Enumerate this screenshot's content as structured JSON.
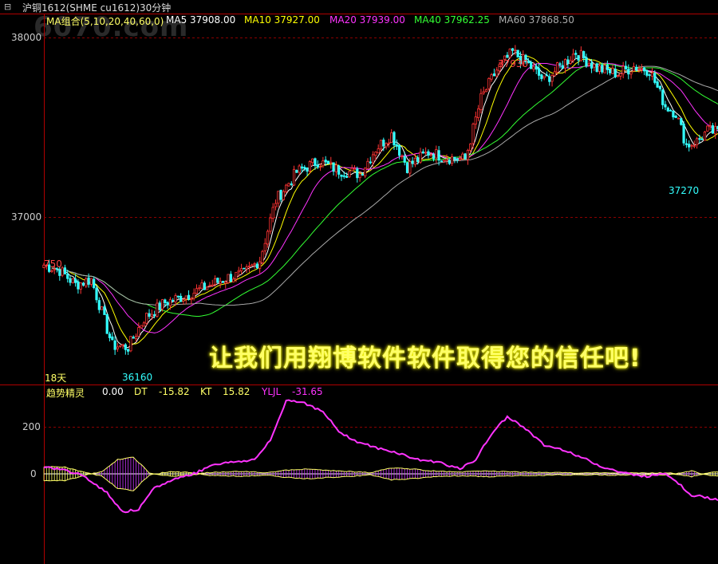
{
  "header": {
    "icon": "window-link-icon",
    "title": "沪铜1612(SHME cu1612)30分钟",
    "watermark": "6070.com"
  },
  "ma_legend": [
    {
      "text": "MA组合(5,10,20,40,60,0)",
      "color": "#ffff66"
    },
    {
      "text": "MA5 37908.00",
      "color": "#ffffff"
    },
    {
      "text": "MA10 37927.00",
      "color": "#ffff00"
    },
    {
      "text": "MA20 37939.00",
      "color": "#ff33ff"
    },
    {
      "text": "MA40 37962.25",
      "color": "#33ff33"
    },
    {
      "text": "MA60 37868.50",
      "color": "#aaaaaa"
    }
  ],
  "price_axis": {
    "ticks": [
      "38000",
      "37000"
    ]
  },
  "annotations": {
    "high": "37930",
    "low": "36160",
    "right_low": "37270",
    "left_value": "750",
    "period_label": "18天"
  },
  "banner": "让我们用翔博软件软件取得您的信任吧!",
  "indicator": {
    "legend": [
      {
        "text": "趋势精灵",
        "color": "#ffff66"
      },
      {
        "text": "0.00",
        "color": "#ffffff"
      },
      {
        "text": "DT",
        "color": "#ffff66"
      },
      {
        "text": "-15.82",
        "color": "#ffff66"
      },
      {
        "text": "KT",
        "color": "#ffff66"
      },
      {
        "text": "15.82",
        "color": "#ffff66"
      },
      {
        "text": "YLJL",
        "color": "#ff33ff"
      },
      {
        "text": "-31.65",
        "color": "#ff33ff"
      }
    ],
    "axis_ticks": [
      "200",
      "0"
    ]
  },
  "colors": {
    "up": "#ff3333",
    "down": "#33ffff",
    "grid": "#8b0000",
    "axis": "#b00000"
  },
  "chart_data": [
    {
      "type": "candlestick",
      "title": "沪铜1612(SHME cu1612)30分钟",
      "ylim": [
        36070,
        38060
      ],
      "yticks": [
        38000,
        37000
      ],
      "anchor_points": [
        [
          0,
          36730
        ],
        [
          6,
          36700
        ],
        [
          12,
          36620
        ],
        [
          18,
          36650
        ],
        [
          26,
          36280
        ],
        [
          32,
          36270
        ],
        [
          38,
          36430
        ],
        [
          46,
          36520
        ],
        [
          54,
          36560
        ],
        [
          62,
          36610
        ],
        [
          70,
          36660
        ],
        [
          76,
          36680
        ],
        [
          82,
          36760
        ],
        [
          88,
          37090
        ],
        [
          96,
          37250
        ],
        [
          104,
          37310
        ],
        [
          112,
          37260
        ],
        [
          120,
          37240
        ],
        [
          126,
          37380
        ],
        [
          132,
          37460
        ],
        [
          138,
          37280
        ],
        [
          146,
          37360
        ],
        [
          154,
          37330
        ],
        [
          160,
          37320
        ],
        [
          166,
          37660
        ],
        [
          172,
          37820
        ],
        [
          178,
          37920
        ],
        [
          184,
          37850
        ],
        [
          190,
          37760
        ],
        [
          196,
          37840
        ],
        [
          202,
          37920
        ],
        [
          210,
          37830
        ],
        [
          218,
          37800
        ],
        [
          224,
          37840
        ],
        [
          230,
          37820
        ],
        [
          236,
          37620
        ],
        [
          240,
          37580
        ],
        [
          244,
          37400
        ],
        [
          248,
          37420
        ],
        [
          252,
          37480
        ],
        [
          256,
          37470
        ]
      ],
      "candle_count": 257,
      "high": 37930,
      "low": 36160,
      "series": [
        {
          "name": "MA5",
          "value": 37908.0
        },
        {
          "name": "MA10",
          "value": 37927.0
        },
        {
          "name": "MA20",
          "value": 37939.0
        },
        {
          "name": "MA40",
          "value": 37962.25
        },
        {
          "name": "MA60",
          "value": 37868.5
        }
      ]
    },
    {
      "type": "area",
      "title": "趋势精灵",
      "ylim": [
        -380,
        370
      ],
      "yticks": [
        200,
        0
      ],
      "DT_anchor": [
        [
          0,
          30
        ],
        [
          8,
          28
        ],
        [
          16,
          5
        ],
        [
          22,
          -10
        ],
        [
          28,
          -60
        ],
        [
          34,
          -70
        ],
        [
          40,
          -5
        ],
        [
          48,
          10
        ],
        [
          56,
          5
        ],
        [
          62,
          -5
        ],
        [
          68,
          -8
        ],
        [
          76,
          -10
        ],
        [
          84,
          -5
        ],
        [
          92,
          -15
        ],
        [
          100,
          -20
        ],
        [
          108,
          -15
        ],
        [
          116,
          -10
        ],
        [
          124,
          -5
        ],
        [
          132,
          -25
        ],
        [
          140,
          -20
        ],
        [
          148,
          -12
        ],
        [
          156,
          -8
        ],
        [
          164,
          -10
        ],
        [
          170,
          -12
        ],
        [
          178,
          -8
        ],
        [
          186,
          -6
        ],
        [
          194,
          -5
        ],
        [
          202,
          -4
        ],
        [
          210,
          -4
        ],
        [
          218,
          -5
        ],
        [
          226,
          -3
        ],
        [
          234,
          -4
        ],
        [
          240,
          -2
        ],
        [
          246,
          -12
        ],
        [
          252,
          5
        ],
        [
          256,
          10
        ]
      ],
      "KT_anchor": [
        [
          0,
          -30
        ],
        [
          8,
          -28
        ],
        [
          16,
          -5
        ],
        [
          22,
          10
        ],
        [
          28,
          60
        ],
        [
          34,
          70
        ],
        [
          40,
          5
        ],
        [
          48,
          -10
        ],
        [
          56,
          -5
        ],
        [
          62,
          5
        ],
        [
          68,
          8
        ],
        [
          76,
          10
        ],
        [
          84,
          5
        ],
        [
          92,
          15
        ],
        [
          100,
          20
        ],
        [
          108,
          15
        ],
        [
          116,
          10
        ],
        [
          124,
          5
        ],
        [
          132,
          25
        ],
        [
          140,
          20
        ],
        [
          148,
          12
        ],
        [
          156,
          8
        ],
        [
          164,
          10
        ],
        [
          170,
          12
        ],
        [
          178,
          8
        ],
        [
          186,
          6
        ],
        [
          194,
          5
        ],
        [
          202,
          4
        ],
        [
          210,
          4
        ],
        [
          218,
          5
        ],
        [
          226,
          3
        ],
        [
          234,
          4
        ],
        [
          240,
          2
        ],
        [
          246,
          12
        ],
        [
          252,
          -5
        ],
        [
          256,
          -10
        ]
      ],
      "YLJL_anchor": [
        [
          0,
          30
        ],
        [
          6,
          20
        ],
        [
          12,
          5
        ],
        [
          18,
          -30
        ],
        [
          24,
          -80
        ],
        [
          30,
          -160
        ],
        [
          36,
          -150
        ],
        [
          42,
          -60
        ],
        [
          50,
          -20
        ],
        [
          58,
          5
        ],
        [
          64,
          40
        ],
        [
          72,
          50
        ],
        [
          80,
          60
        ],
        [
          86,
          140
        ],
        [
          92,
          310
        ],
        [
          98,
          305
        ],
        [
          106,
          260
        ],
        [
          112,
          180
        ],
        [
          118,
          140
        ],
        [
          126,
          110
        ],
        [
          134,
          90
        ],
        [
          142,
          60
        ],
        [
          150,
          50
        ],
        [
          158,
          20
        ],
        [
          164,
          60
        ],
        [
          170,
          170
        ],
        [
          176,
          240
        ],
        [
          182,
          200
        ],
        [
          190,
          120
        ],
        [
          198,
          100
        ],
        [
          206,
          60
        ],
        [
          212,
          30
        ],
        [
          218,
          10
        ],
        [
          224,
          -5
        ],
        [
          230,
          -10
        ],
        [
          236,
          5
        ],
        [
          240,
          -30
        ],
        [
          246,
          -90
        ],
        [
          252,
          -100
        ],
        [
          256,
          -110
        ]
      ],
      "series": [
        {
          "name": "DT",
          "value": -15.82
        },
        {
          "name": "KT",
          "value": 15.82
        },
        {
          "name": "YLJL",
          "value": -31.65
        }
      ]
    }
  ]
}
